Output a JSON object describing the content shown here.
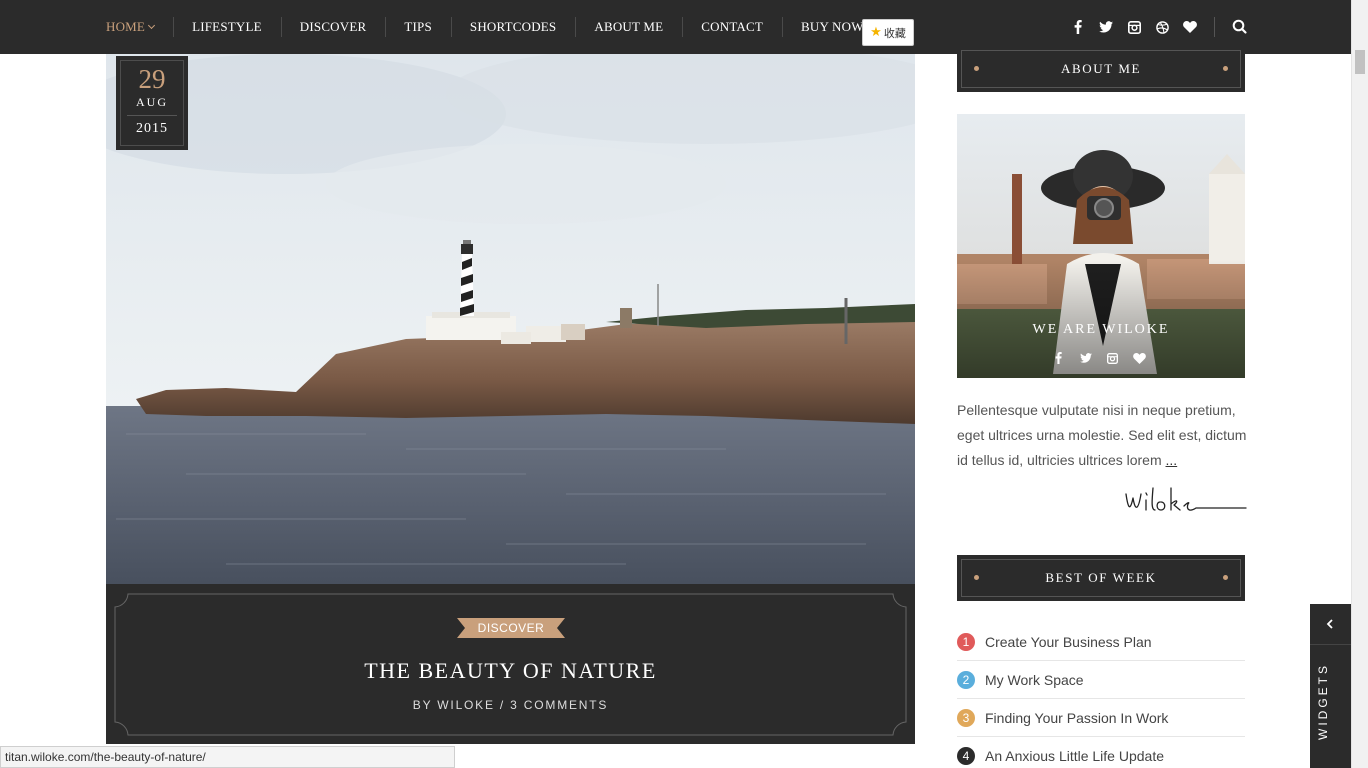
{
  "nav": {
    "items": [
      {
        "label": "HOME",
        "active": true,
        "has_dropdown": true
      },
      {
        "label": "LIFESTYLE"
      },
      {
        "label": "DISCOVER"
      },
      {
        "label": "TIPS"
      },
      {
        "label": "SHORTCODES"
      },
      {
        "label": "ABOUT ME"
      },
      {
        "label": "CONTACT"
      },
      {
        "label": "BUY NOW"
      }
    ],
    "collect_button": "收藏",
    "social_icons": [
      "facebook-icon",
      "twitter-icon",
      "instagram-icon",
      "dribbble-icon",
      "heart-icon"
    ],
    "search_icon": "search-icon"
  },
  "post": {
    "date": {
      "day": "29",
      "month": "AUG",
      "year": "2015"
    },
    "category": "DISCOVER",
    "title": "THE BEAUTY OF NATURE",
    "meta": "BY WILOKE / 3 COMMENTS"
  },
  "sidebar": {
    "about": {
      "heading": "ABOUT ME",
      "name": "WE ARE WILOKE",
      "social_icons": [
        "facebook-icon",
        "twitter-icon",
        "instagram-icon",
        "heart-icon"
      ],
      "text": "Pellentesque vulputate nisi in neque pretium, eget ultrices urna molestie. Sed elit est, dictum id tellus id, ultricies ultrices lorem ",
      "more": "...",
      "signature": "Wiloke"
    },
    "best_of_week": {
      "heading": "BEST OF WEEK",
      "items": [
        {
          "num": "1",
          "title": "Create Your Business Plan",
          "color": "#e05a5a"
        },
        {
          "num": "2",
          "title": "My Work Space",
          "color": "#5aaedc"
        },
        {
          "num": "3",
          "title": "Finding Your Passion In Work",
          "color": "#e0a85a"
        },
        {
          "num": "4",
          "title": "An Anxious Little Life Update",
          "color": "#2b2b2b"
        }
      ]
    }
  },
  "widgets_tab": {
    "label": "WIDGETS"
  },
  "status_bar": {
    "url": "titan.wiloke.com/the-beauty-of-nature/"
  },
  "colors": {
    "accent": "#c9a07c",
    "dark": "#2b2b2b"
  }
}
